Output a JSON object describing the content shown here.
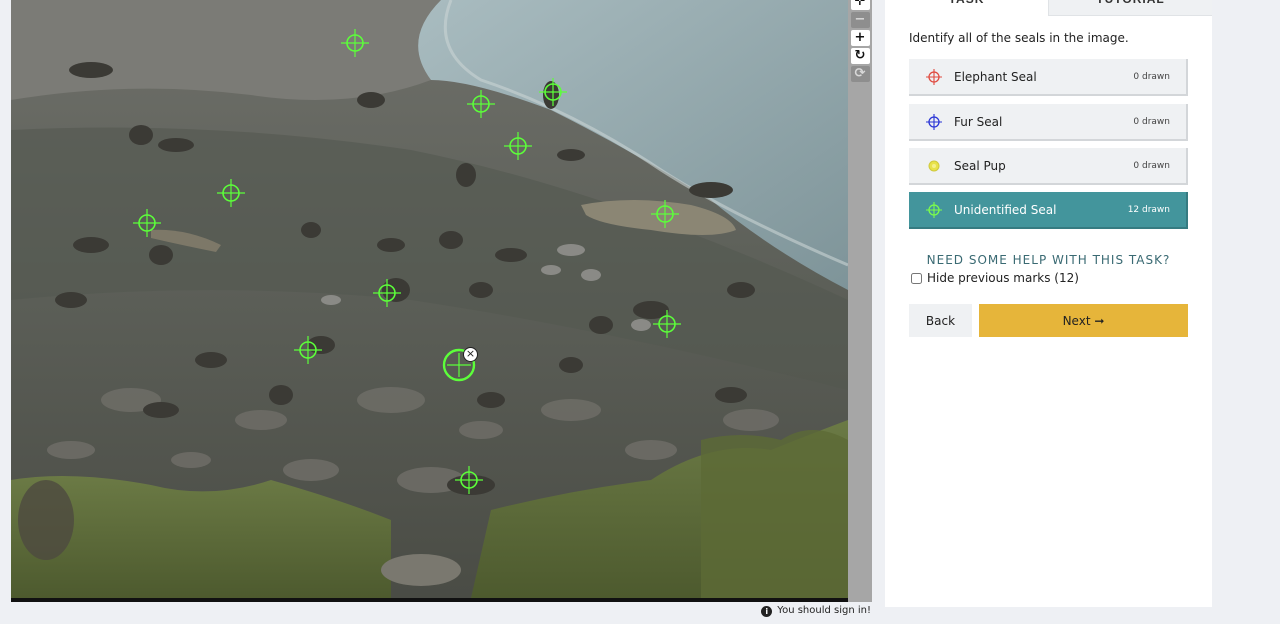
{
  "viewer": {
    "photo_name": "seal-colony-photo",
    "marker_color": "#5cff3a",
    "selected_mark_delete_icon": "close-circle-icon"
  },
  "toolbar": {
    "pan_icon": "move-icon",
    "zoom_out_icon": "minus-icon",
    "zoom_in_icon": "plus-icon",
    "rotate_icon": "rotate-icon",
    "reset_icon": "refresh-icon",
    "pan": "✛",
    "zoom_out": "−",
    "zoom_in": "+",
    "rotate": "↻",
    "reset": "⟳"
  },
  "signin": {
    "text": "You should sign in!",
    "icon": "info-icon",
    "icon_glyph": "i"
  },
  "panel": {
    "tabs": [
      {
        "label": "TASK",
        "active": true
      },
      {
        "label": "TUTORIAL",
        "active": false
      }
    ],
    "instruction": "Identify all of the seals in the image.",
    "tools": [
      {
        "label": "Elephant Seal",
        "count": "0 drawn",
        "color": "#e04a3f",
        "icon": "crosshair-icon",
        "active": false
      },
      {
        "label": "Fur Seal",
        "count": "0 drawn",
        "color": "#2a35d6",
        "icon": "crosshair-icon",
        "active": false
      },
      {
        "label": "Seal Pup",
        "count": "0 drawn",
        "color": "#e8e24a",
        "icon": "dot-icon",
        "active": false
      },
      {
        "label": "Unidentified Seal",
        "count": "12 drawn",
        "color": "#7dff4a",
        "icon": "crosshair-icon",
        "active": true
      }
    ],
    "help": "NEED SOME HELP WITH THIS TASK?",
    "hide_marks": "Hide previous marks (12)",
    "hide_marks_checked": false,
    "back_label": "Back",
    "next_label": "Next",
    "next_arrow": "➞",
    "colors": {
      "active_tool": "#43959c",
      "next_button": "#e6b53a",
      "help_text": "#3a6a73"
    }
  }
}
